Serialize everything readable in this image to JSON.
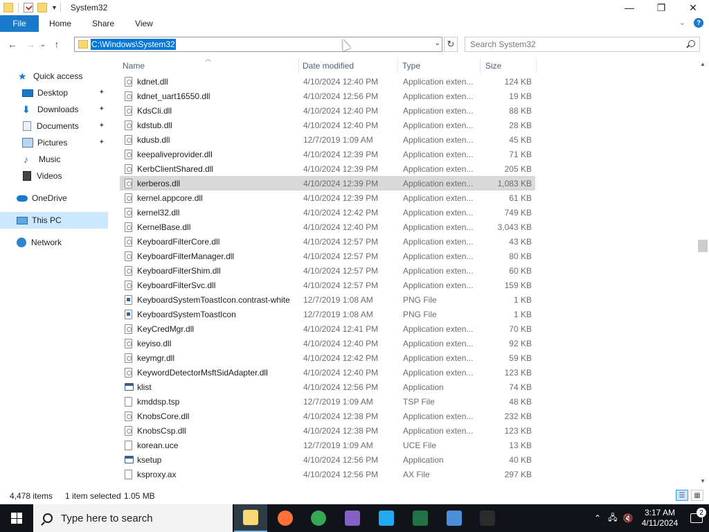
{
  "window": {
    "title": "System32",
    "minimize": "—",
    "maximize": "❐",
    "close": "✕"
  },
  "ribbon": {
    "tabs": [
      "File",
      "Home",
      "Share",
      "View"
    ],
    "expand": "⌄",
    "help": "?"
  },
  "nav": {
    "back": "←",
    "forward": "→",
    "recent": "⌄",
    "up": "↑",
    "address": "C:\\Windows\\System32",
    "address_caret": "⌄",
    "refresh": "↻",
    "search_placeholder": "Search System32"
  },
  "sidebar": {
    "items": [
      {
        "label": "Quick access",
        "icon": "star-icon",
        "pinned": false
      },
      {
        "label": "Desktop",
        "icon": "desktop-icon",
        "pinned": true
      },
      {
        "label": "Downloads",
        "icon": "downloads-icon",
        "pinned": true
      },
      {
        "label": "Documents",
        "icon": "documents-icon",
        "pinned": true
      },
      {
        "label": "Pictures",
        "icon": "pictures-icon",
        "pinned": true
      },
      {
        "label": "Music",
        "icon": "music-icon",
        "pinned": false
      },
      {
        "label": "Videos",
        "icon": "videos-icon",
        "pinned": false
      },
      {
        "label": "OneDrive",
        "icon": "cloud-icon",
        "pinned": false
      },
      {
        "label": "This PC",
        "icon": "computer-icon",
        "pinned": false,
        "selected": true
      },
      {
        "label": "Network",
        "icon": "network-icon",
        "pinned": false
      }
    ],
    "pin_glyph": "📌"
  },
  "columns": {
    "name": "Name",
    "date": "Date modified",
    "type": "Type",
    "size": "Size"
  },
  "files": [
    {
      "name": "kdnet.dll",
      "date": "4/10/2024 12:40 PM",
      "type": "Application exten...",
      "size": "124 KB",
      "icon": "dll"
    },
    {
      "name": "kdnet_uart16550.dll",
      "date": "4/10/2024 12:56 PM",
      "type": "Application exten...",
      "size": "19 KB",
      "icon": "dll"
    },
    {
      "name": "KdsCli.dll",
      "date": "4/10/2024 12:40 PM",
      "type": "Application exten...",
      "size": "88 KB",
      "icon": "dll"
    },
    {
      "name": "kdstub.dll",
      "date": "4/10/2024 12:40 PM",
      "type": "Application exten...",
      "size": "28 KB",
      "icon": "dll"
    },
    {
      "name": "kdusb.dll",
      "date": "12/7/2019 1:09 AM",
      "type": "Application exten...",
      "size": "45 KB",
      "icon": "dll"
    },
    {
      "name": "keepaliveprovider.dll",
      "date": "4/10/2024 12:39 PM",
      "type": "Application exten...",
      "size": "71 KB",
      "icon": "dll"
    },
    {
      "name": "KerbClientShared.dll",
      "date": "4/10/2024 12:39 PM",
      "type": "Application exten...",
      "size": "205 KB",
      "icon": "dll"
    },
    {
      "name": "kerberos.dll",
      "date": "4/10/2024 12:39 PM",
      "type": "Application exten...",
      "size": "1,083 KB",
      "icon": "dll",
      "selected": true
    },
    {
      "name": "kernel.appcore.dll",
      "date": "4/10/2024 12:39 PM",
      "type": "Application exten...",
      "size": "61 KB",
      "icon": "dll"
    },
    {
      "name": "kernel32.dll",
      "date": "4/10/2024 12:42 PM",
      "type": "Application exten...",
      "size": "749 KB",
      "icon": "dll"
    },
    {
      "name": "KernelBase.dll",
      "date": "4/10/2024 12:40 PM",
      "type": "Application exten...",
      "size": "3,043 KB",
      "icon": "dll"
    },
    {
      "name": "KeyboardFilterCore.dll",
      "date": "4/10/2024 12:57 PM",
      "type": "Application exten...",
      "size": "43 KB",
      "icon": "dll"
    },
    {
      "name": "KeyboardFilterManager.dll",
      "date": "4/10/2024 12:57 PM",
      "type": "Application exten...",
      "size": "80 KB",
      "icon": "dll"
    },
    {
      "name": "KeyboardFilterShim.dll",
      "date": "4/10/2024 12:57 PM",
      "type": "Application exten...",
      "size": "60 KB",
      "icon": "dll"
    },
    {
      "name": "KeyboardFilterSvc.dll",
      "date": "4/10/2024 12:57 PM",
      "type": "Application exten...",
      "size": "159 KB",
      "icon": "dll"
    },
    {
      "name": "KeyboardSystemToastIcon.contrast-white",
      "date": "12/7/2019 1:08 AM",
      "type": "PNG File",
      "size": "1 KB",
      "icon": "png"
    },
    {
      "name": "KeyboardSystemToastIcon",
      "date": "12/7/2019 1:08 AM",
      "type": "PNG File",
      "size": "1 KB",
      "icon": "png"
    },
    {
      "name": "KeyCredMgr.dll",
      "date": "4/10/2024 12:41 PM",
      "type": "Application exten...",
      "size": "70 KB",
      "icon": "dll"
    },
    {
      "name": "keyiso.dll",
      "date": "4/10/2024 12:40 PM",
      "type": "Application exten...",
      "size": "92 KB",
      "icon": "dll"
    },
    {
      "name": "keymgr.dll",
      "date": "4/10/2024 12:42 PM",
      "type": "Application exten...",
      "size": "59 KB",
      "icon": "dll"
    },
    {
      "name": "KeywordDetectorMsftSidAdapter.dll",
      "date": "4/10/2024 12:40 PM",
      "type": "Application exten...",
      "size": "123 KB",
      "icon": "dll"
    },
    {
      "name": "klist",
      "date": "4/10/2024 12:56 PM",
      "type": "Application",
      "size": "74 KB",
      "icon": "app"
    },
    {
      "name": "kmddsp.tsp",
      "date": "12/7/2019 1:09 AM",
      "type": "TSP File",
      "size": "48 KB",
      "icon": "file"
    },
    {
      "name": "KnobsCore.dll",
      "date": "4/10/2024 12:38 PM",
      "type": "Application exten...",
      "size": "232 KB",
      "icon": "dll"
    },
    {
      "name": "KnobsCsp.dll",
      "date": "4/10/2024 12:38 PM",
      "type": "Application exten...",
      "size": "123 KB",
      "icon": "dll"
    },
    {
      "name": "korean.uce",
      "date": "12/7/2019 1:09 AM",
      "type": "UCE File",
      "size": "13 KB",
      "icon": "file"
    },
    {
      "name": "ksetup",
      "date": "4/10/2024 12:56 PM",
      "type": "Application",
      "size": "40 KB",
      "icon": "app"
    },
    {
      "name": "ksproxy.ax",
      "date": "4/10/2024 12:56 PM",
      "type": "AX File",
      "size": "297 KB",
      "icon": "file"
    }
  ],
  "status": {
    "count": "4,478 items",
    "selected": "1 item selected",
    "size": "1.05 MB"
  },
  "scrollbar": {
    "up": "▲",
    "down": "▼"
  },
  "taskbar": {
    "search_placeholder": "Type here to search",
    "apps": [
      {
        "name": "file-explorer",
        "color": "#f8d775",
        "active": true
      },
      {
        "name": "firefox",
        "color": "#ff7139"
      },
      {
        "name": "chrome",
        "color": "#34a853"
      },
      {
        "name": "visual-studio",
        "color": "#8661c5"
      },
      {
        "name": "vscode",
        "color": "#23a9f2"
      },
      {
        "name": "excel-app",
        "color": "#217346"
      },
      {
        "name": "remote-desktop",
        "color": "#4a90d9"
      },
      {
        "name": "terminal",
        "color": "#2b2b2b"
      }
    ],
    "tray": {
      "chevron": "⌃",
      "network": "🖧",
      "volume": "🔇",
      "time": "3:17 AM",
      "date": "4/11/2024",
      "notification_count": "2"
    }
  },
  "colors": {
    "accent": "#1979ca",
    "selection": "#cce8ff",
    "row_selected": "#d9d9d9",
    "address_highlight": "#0078d7",
    "taskbar": "#101418"
  }
}
